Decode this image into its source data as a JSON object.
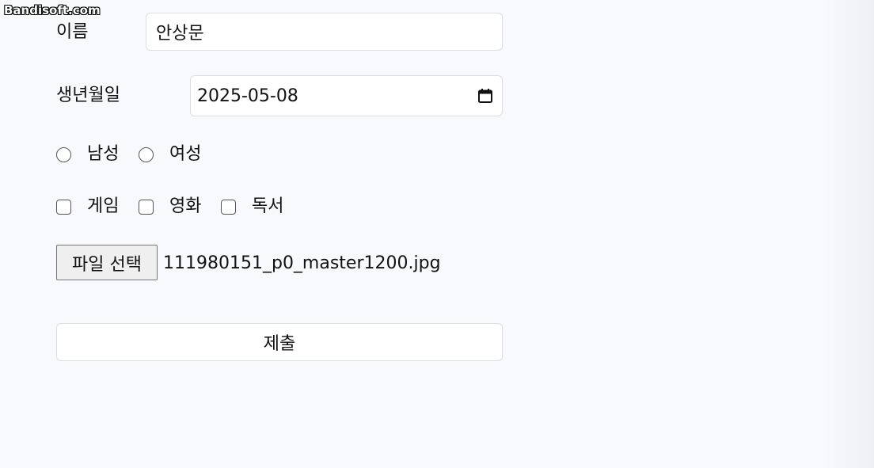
{
  "watermark": "Bandisoft.com",
  "form": {
    "name_label": "이름",
    "name_value": "안상문",
    "birth_label": "생년월일",
    "birth_value": "2025-05-08",
    "gender_options": [
      "남성",
      "여성"
    ],
    "hobby_options": [
      "게임",
      "영화",
      "독서"
    ],
    "file_button_label": "파일 선택",
    "file_name": "111980151_p0_master1200.jpg",
    "submit_label": "제출"
  },
  "icons": {
    "date_picker": "calendar-icon"
  }
}
